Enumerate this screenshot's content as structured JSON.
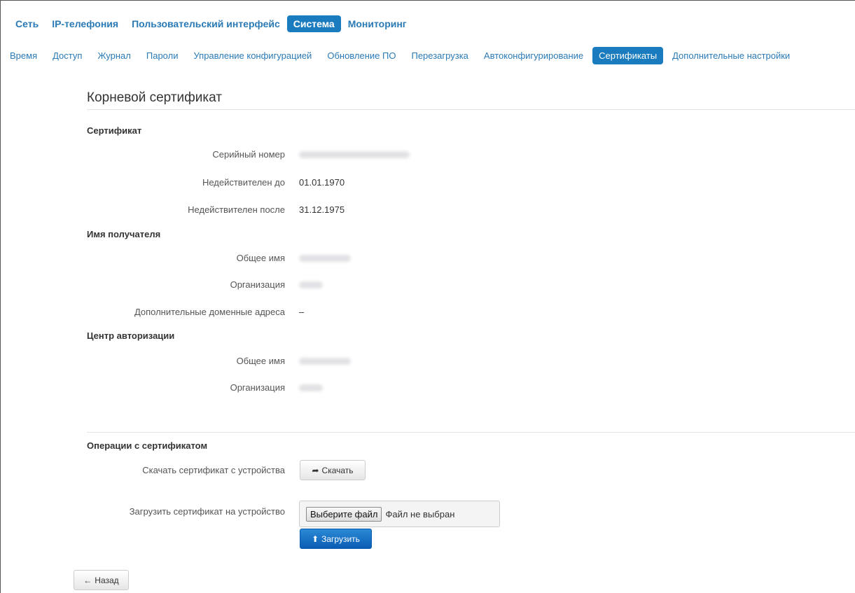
{
  "topnav": [
    {
      "label": "Сеть",
      "active": false
    },
    {
      "label": "IP-телефония",
      "active": false
    },
    {
      "label": "Пользовательский интерфейс",
      "active": false
    },
    {
      "label": "Система",
      "active": true
    },
    {
      "label": "Мониторинг",
      "active": false
    }
  ],
  "subnav": [
    {
      "label": "Время",
      "active": false
    },
    {
      "label": "Доступ",
      "active": false
    },
    {
      "label": "Журнал",
      "active": false
    },
    {
      "label": "Пароли",
      "active": false
    },
    {
      "label": "Управление конфигурацией",
      "active": false
    },
    {
      "label": "Обновление ПО",
      "active": false
    },
    {
      "label": "Перезагрузка",
      "active": false
    },
    {
      "label": "Автоконфигурирование",
      "active": false
    },
    {
      "label": "Сертификаты",
      "active": true
    },
    {
      "label": "Дополнительные настройки",
      "active": false
    }
  ],
  "page": {
    "title": "Корневой сертификат"
  },
  "certificate": {
    "section": "Сертификат",
    "serial_label": "Серийный номер",
    "valid_from_label": "Недействителен до",
    "valid_from": "01.01.1970",
    "valid_to_label": "Недействителен после",
    "valid_to": "31.12.1975"
  },
  "subject": {
    "section": "Имя получателя",
    "cn_label": "Общее имя",
    "org_label": "Организация",
    "san_label": "Дополнительные доменные адреса",
    "san_value": "–"
  },
  "issuer": {
    "section": "Центр авторизации",
    "cn_label": "Общее имя",
    "org_label": "Организация"
  },
  "operations": {
    "section": "Операции с сертификатом",
    "download_label": "Скачать сертификат с устройства",
    "download_button": "Скачать",
    "upload_label": "Загрузить сертификат на устройство",
    "choose_file": "Выберите файл",
    "no_file": "Файл не выбран",
    "upload_button": "Загрузить"
  },
  "back_button": "Назад",
  "colors": {
    "accent": "#1a7cbf",
    "link": "#2a7ab6",
    "primary_button": "#0a5cb4"
  }
}
